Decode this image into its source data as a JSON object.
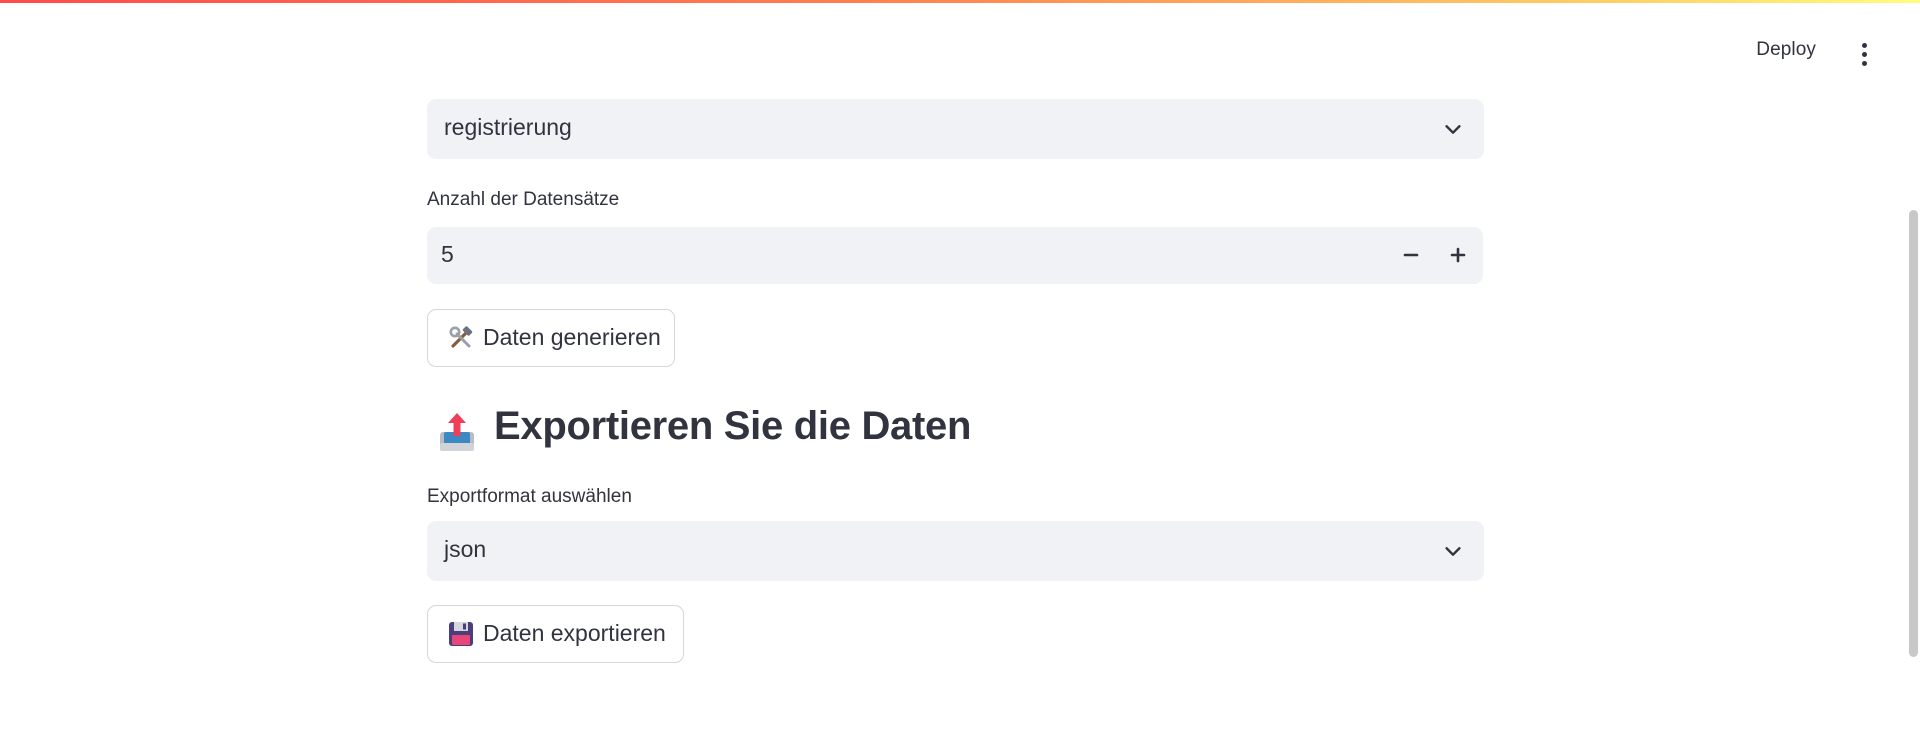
{
  "header": {
    "deploy_label": "Deploy",
    "menu_icon": "kebab-menu-icon"
  },
  "main": {
    "template_select": {
      "value": "registrierung",
      "icon": "chevron-down-icon"
    },
    "record_count": {
      "label": "Anzahl der Datensätze",
      "value": "5",
      "decrement_icon": "minus-icon",
      "increment_icon": "plus-icon"
    },
    "generate_button": {
      "icon": "hammer-and-wrench-icon",
      "label": "Daten generieren"
    },
    "export_section": {
      "icon": "outbox-tray-icon",
      "title": "Exportieren Sie die Daten"
    },
    "export_format": {
      "label": "Exportformat auswählen",
      "value": "json",
      "icon": "chevron-down-icon"
    },
    "export_button": {
      "icon": "floppy-disk-icon",
      "label": "Daten exportieren"
    }
  },
  "colors": {
    "input_bg": "#f0f2f6",
    "text": "#31333f",
    "accent_red": "#ff4b4b",
    "gradient_end": "#fffd80"
  }
}
